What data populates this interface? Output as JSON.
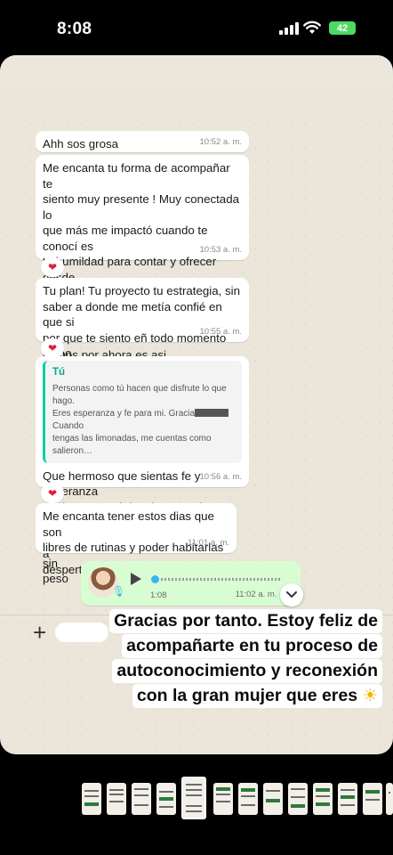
{
  "status_bar": {
    "time": "8:08",
    "battery": "42"
  },
  "messages": [
    {
      "text": "Ahh sos grosa",
      "time": "10:52 a. m."
    },
    {
      "text": "Me encanta tu forma de acompañar te\nsiento muy presente ! Muy conectada lo\nque más me impactó cuando te conocí es\ntu humildad para contar y ofrecer desde\ntu experiencia lo que Tenes para dar para\nayudar y que encontraste tu propósito al\nmenos por ahora es asi",
      "time": "10:53 a. m.",
      "reaction": "❤"
    },
    {
      "text": "Tu plan! Tu proyecto tu estrategia, sin\nsaber a donde me metía confié en que si\npor que te siento eñ todo momento como\nverídica me sale",
      "time": "10:55 a. m.",
      "reaction": "❤"
    },
    {
      "quote_author": "Tú",
      "quote_text_a": "Personas como tú hacen que disfrute lo que hago.\nEres esperanza y fe para mi. Gracia",
      "quote_text_b": " Cuando\ntengas las limonadas, me cuentas como salieron…",
      "text": "Que hermoso que sientas fe y esperanza\nme haces sentir lo mismo a mi con todo\neste proceso transitando me ayudas a\ndespertar",
      "time": "10:56 a. m.",
      "reaction": "❤"
    },
    {
      "text": "Me encanta tener estos dias que son\nlibres de rutinas y poder habitarlas sin\npeso",
      "time": "11:01 a. m."
    }
  ],
  "voice_note": {
    "duration": "1:08",
    "time": "11:02 a. m.",
    "ticks": "✓✓",
    "accent": "#34b7f1"
  },
  "caption": {
    "line1": "Gracias por tanto. Estoy feliz de",
    "line2": "acompañarte en tu proceso de",
    "line3": "autoconocimiento y reconexión",
    "line4": "con la gran mujer que eres",
    "emoji": "☀"
  },
  "input": {
    "plus": "+"
  },
  "colors": {
    "chat_bg": "#ebe6d9",
    "outgoing": "#d9fdd3",
    "accent_green": "#06cf9c"
  }
}
